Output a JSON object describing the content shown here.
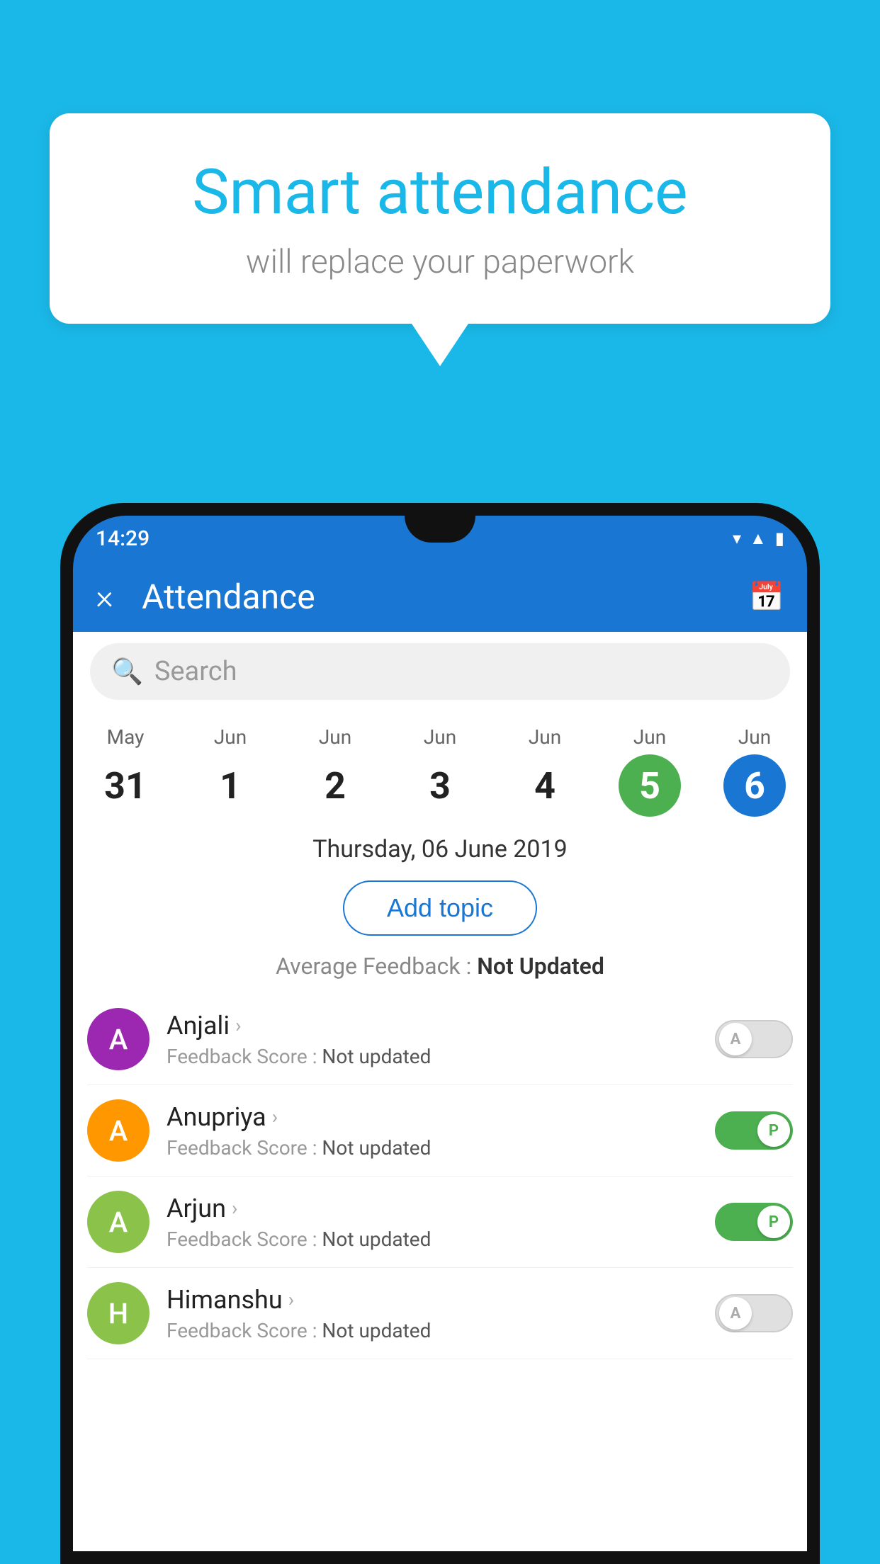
{
  "background": {
    "color": "#1ab8e8"
  },
  "speech_bubble": {
    "title": "Smart attendance",
    "subtitle": "will replace your paperwork"
  },
  "status_bar": {
    "time": "14:29",
    "icons": [
      "wifi",
      "signal",
      "battery"
    ]
  },
  "app_bar": {
    "title": "Attendance",
    "close_label": "×",
    "calendar_icon": "📅"
  },
  "search": {
    "placeholder": "Search"
  },
  "dates": [
    {
      "month": "May",
      "day": "31",
      "state": "normal"
    },
    {
      "month": "Jun",
      "day": "1",
      "state": "normal"
    },
    {
      "month": "Jun",
      "day": "2",
      "state": "normal"
    },
    {
      "month": "Jun",
      "day": "3",
      "state": "normal"
    },
    {
      "month": "Jun",
      "day": "4",
      "state": "normal"
    },
    {
      "month": "Jun",
      "day": "5",
      "state": "today"
    },
    {
      "month": "Jun",
      "day": "6",
      "state": "selected"
    }
  ],
  "selected_date": "Thursday, 06 June 2019",
  "add_topic_label": "Add topic",
  "average_feedback": {
    "label": "Average Feedback : ",
    "value": "Not Updated"
  },
  "students": [
    {
      "name": "Anjali",
      "avatar_letter": "A",
      "avatar_color": "#9c27b0",
      "feedback_label": "Feedback Score : ",
      "feedback_value": "Not updated",
      "toggle_state": "off",
      "toggle_label": "A"
    },
    {
      "name": "Anupriya",
      "avatar_letter": "A",
      "avatar_color": "#ff9800",
      "feedback_label": "Feedback Score : ",
      "feedback_value": "Not updated",
      "toggle_state": "on",
      "toggle_label": "P"
    },
    {
      "name": "Arjun",
      "avatar_letter": "A",
      "avatar_color": "#8bc34a",
      "feedback_label": "Feedback Score : ",
      "feedback_value": "Not updated",
      "toggle_state": "on",
      "toggle_label": "P"
    },
    {
      "name": "Himanshu",
      "avatar_letter": "H",
      "avatar_color": "#8bc34a",
      "feedback_label": "Feedback Score : ",
      "feedback_value": "Not updated",
      "toggle_state": "off",
      "toggle_label": "A"
    }
  ]
}
